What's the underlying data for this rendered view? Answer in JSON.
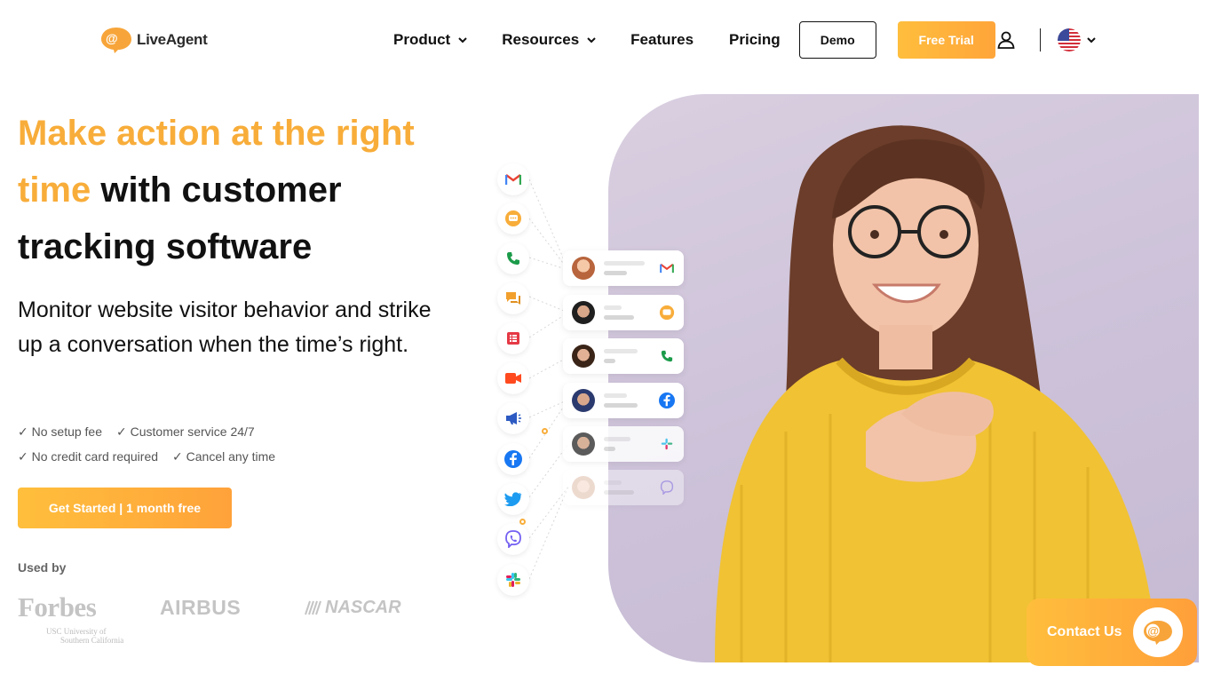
{
  "header": {
    "logo_text": "LiveAgent",
    "nav": {
      "product": "Product",
      "resources": "Resources",
      "features": "Features",
      "pricing": "Pricing"
    },
    "demo_label": "Demo",
    "trial_label": "Free Trial",
    "user_icon": "user-icon",
    "language_flag": "us-flag-icon"
  },
  "hero": {
    "headline_highlight_1": "Make action at the right",
    "headline_highlight_2": "time",
    "headline_rest_1": " with customer",
    "headline_rest_2": "tracking software",
    "subtitle": "Monitor website visitor behavior and strike up a conversation when the time’s right.",
    "checks": [
      "✓ No setup fee",
      "✓ Customer service 24/7",
      "✓ No credit card required",
      "✓ Cancel any time"
    ],
    "cta_label": "Get Started | 1 month free",
    "used_by_label": "Used by",
    "client_logos": {
      "forbes": "Forbes",
      "airbus": "AIRBUS",
      "nascar": "NASCAR",
      "usc_line1": "USC University of",
      "usc_line2": "Southern California"
    }
  },
  "channels": [
    "gmail-icon",
    "chat-icon",
    "phone-icon",
    "messages-icon",
    "form-icon",
    "video-icon",
    "megaphone-icon",
    "facebook-icon",
    "twitter-icon",
    "viber-icon",
    "slack-icon"
  ],
  "contact_widget": {
    "label": "Contact Us"
  },
  "colors": {
    "accent": "#f8ad3a",
    "accent_dark": "#ff9f3a",
    "text": "#111111",
    "muted": "#666666",
    "hero_bg": "#cdc2d9"
  }
}
